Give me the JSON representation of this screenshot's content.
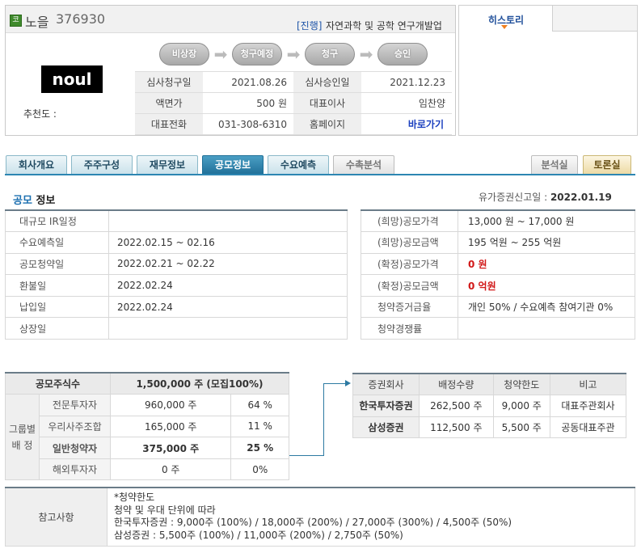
{
  "company": {
    "badge": "코",
    "name": "노을",
    "code": "376930",
    "status": "[진행]",
    "industry": "자연과학 및 공학 연구개발업",
    "logo_text": "noul",
    "recommend_label": "추천도 :"
  },
  "stages": [
    "비상장",
    "청구예정",
    "청구",
    "승인"
  ],
  "info_rows": [
    {
      "label1": "심사청구일",
      "value1": "2021.08.26",
      "label2": "심사승인일",
      "value2": "2021.12.23"
    },
    {
      "label1": "액면가",
      "value1": "500 원",
      "label2": "대표이사",
      "value2": "임찬양"
    },
    {
      "label1": "대표전화",
      "value1": "031-308-6310",
      "label2": "홈페이지",
      "value2": "바로가기"
    }
  ],
  "history_tab": "히스토리",
  "tabs": [
    "회사개요",
    "주주구성",
    "재무정보",
    "공모정보",
    "수요예측",
    "수촉분석",
    "분석실",
    "토론실"
  ],
  "section": {
    "title_blue": "공모",
    "title_rest": " 정보",
    "filing_label": "유가증권신고일 : ",
    "filing_date": "2022.01.19"
  },
  "schedule": [
    {
      "label": "대규모 IR일정",
      "value": ""
    },
    {
      "label": "수요예측일",
      "value": "2022.02.15 ~ 02.16"
    },
    {
      "label": "공모청약일",
      "value": "2022.02.21 ~ 02.22"
    },
    {
      "label": "환불일",
      "value": "2022.02.24"
    },
    {
      "label": "납입일",
      "value": "2022.02.24"
    },
    {
      "label": "상장일",
      "value": ""
    }
  ],
  "pricing": [
    {
      "label": "(희망)공모가격",
      "value": "13,000 원 ~ 17,000 원"
    },
    {
      "label": "(희망)공모금액",
      "value": "195 억원  ~ 255 억원"
    },
    {
      "label": "(확정)공모가격",
      "value": "0 원"
    },
    {
      "label": "(확정)공모금액",
      "value": "0 억원"
    },
    {
      "label": "청약증거금율",
      "value": "개인 50% / 수요예측 참여기관 0%"
    },
    {
      "label": "청약경쟁률",
      "value": ""
    }
  ],
  "allocation": {
    "total_label": "공모주식수",
    "total_value": "1,500,000  주 (모집100%)",
    "group_label_1": "그룹별",
    "group_label_2": "배  정",
    "rows": [
      {
        "name": "전문투자자",
        "shares": "960,000 주",
        "pct": "64 %"
      },
      {
        "name": "우리사주조합",
        "shares": "165,000 주",
        "pct": "11 %"
      },
      {
        "name": "일반청약자",
        "shares": "375,000  주",
        "pct": "25 %"
      },
      {
        "name": "해외투자자",
        "shares": "0 주",
        "pct": "0%"
      }
    ]
  },
  "underwriters": {
    "headers": [
      "증권회사",
      "배정수량",
      "청약한도",
      "비고"
    ],
    "rows": [
      {
        "firm": "한국투자증권",
        "qty": "262,500 주",
        "limit": "9,000 주",
        "note": "대표주관회사"
      },
      {
        "firm": "삼성증권",
        "qty": "112,500 주",
        "limit": "5,500 주",
        "note": "공동대표주관"
      }
    ]
  },
  "notes": {
    "label": "참고사항",
    "lines": [
      "*청약한도",
      "청약 및 우대 단위에 따라",
      "한국투자증권 : 9,000주 (100%) / 18,000주 (200%) / 27,000주 (300%) / 4,500주 (50%)",
      "삼성증권 : 5,500주 (100%) / 11,000주 (200%) / 2,750주 (50%)"
    ]
  }
}
